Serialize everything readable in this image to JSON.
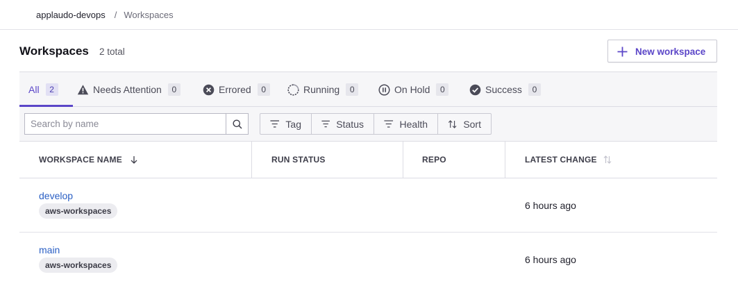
{
  "breadcrumb": {
    "org": "applaudo-devops",
    "separator": "/",
    "page": "Workspaces"
  },
  "header": {
    "title": "Workspaces",
    "total": "2 total",
    "new_button": "New workspace"
  },
  "tabs": [
    {
      "label": "All",
      "count": "2",
      "icon": "none",
      "active": true
    },
    {
      "label": "Needs Attention",
      "count": "0",
      "icon": "warning-icon"
    },
    {
      "label": "Errored",
      "count": "0",
      "icon": "error-icon"
    },
    {
      "label": "Running",
      "count": "0",
      "icon": "running-icon"
    },
    {
      "label": "On Hold",
      "count": "0",
      "icon": "pause-icon"
    },
    {
      "label": "Success",
      "count": "0",
      "icon": "success-icon"
    }
  ],
  "search": {
    "placeholder": "Search by name",
    "value": ""
  },
  "filters": {
    "tag": "Tag",
    "status": "Status",
    "health": "Health",
    "sort": "Sort"
  },
  "table": {
    "columns": [
      "WORKSPACE NAME",
      "RUN STATUS",
      "REPO",
      "LATEST CHANGE"
    ],
    "rows": [
      {
        "name": "develop",
        "tag": "aws-workspaces",
        "run_status": "",
        "repo": "",
        "latest_change": "6 hours ago"
      },
      {
        "name": "main",
        "tag": "aws-workspaces",
        "run_status": "",
        "repo": "",
        "latest_change": "6 hours ago"
      }
    ]
  },
  "colors": {
    "accent": "#5b46c8",
    "link": "#2a5fc4",
    "text": "#1f1f2a",
    "muted": "#6b6b78"
  }
}
